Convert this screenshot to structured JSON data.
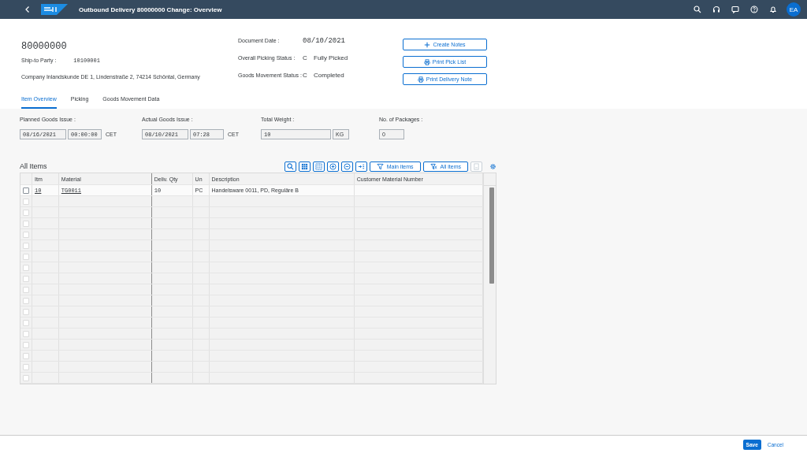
{
  "shell": {
    "title": "Outbound Delivery 80000000 Change: Overview",
    "avatar": "EA"
  },
  "header": {
    "document_number": "80000000",
    "ship_to_label": "Ship-to Party :",
    "ship_to_value": "10100001",
    "address": "Company Inlandskunde DE 1, Lindenstraße 2, 74214 Schöntal, Germany",
    "fields": [
      {
        "label": "Document Date :",
        "value": "08/10/2021",
        "kind": "date"
      },
      {
        "label": "Overall Picking Status :",
        "code": "C",
        "value": "Fully Picked",
        "kind": "status"
      },
      {
        "label": "Goods Movement Status :",
        "code": "C",
        "value": "Completed",
        "kind": "status"
      }
    ],
    "buttons": [
      {
        "label": "Create Notes"
      },
      {
        "label": "Print Pick List"
      },
      {
        "label": "Print Delivery Note"
      }
    ]
  },
  "tabs": [
    {
      "label": "Item Overview",
      "selected": true
    },
    {
      "label": "Picking",
      "selected": false
    },
    {
      "label": "Goods Movement Data",
      "selected": false
    }
  ],
  "issue_groups": [
    {
      "label": "Planned Goods Issue :",
      "inputs": [
        {
          "value": "08/16/2021",
          "kind": "date"
        },
        {
          "value": "00:00:00",
          "kind": "time"
        }
      ],
      "suffix": "CET"
    },
    {
      "label": "Actual Goods Issue :",
      "inputs": [
        {
          "value": "08/10/2021",
          "kind": "date"
        },
        {
          "value": "07:28",
          "kind": "time"
        }
      ],
      "suffix": "CET"
    },
    {
      "label": "Total Weight :",
      "inputs": [
        {
          "value": "10",
          "kind": "wide"
        },
        {
          "value": "KG",
          "kind": "unit"
        }
      ]
    },
    {
      "label": "No. of Packages :",
      "inputs": [
        {
          "value": "0",
          "kind": "unit"
        }
      ]
    }
  ],
  "table": {
    "title": "All Items",
    "toolbar": [
      {
        "kind": "icon",
        "disabled": false
      },
      {
        "kind": "icon",
        "disabled": false
      },
      {
        "kind": "icon",
        "disabled": false
      },
      {
        "kind": "icon",
        "disabled": false
      },
      {
        "kind": "icon",
        "disabled": false
      },
      {
        "kind": "icon",
        "disabled": false
      },
      {
        "kind": "text",
        "label": "Main items",
        "disabled": false
      },
      {
        "kind": "text",
        "label": "All items",
        "disabled": false
      },
      {
        "kind": "icon",
        "disabled": true
      }
    ],
    "columns": [
      {
        "label": "Itm",
        "kind": "link"
      },
      {
        "label": "Material",
        "kind": "link"
      },
      {
        "label": "Deliv. Qty",
        "kind": "mono"
      },
      {
        "label": "Un",
        "kind": "text"
      },
      {
        "label": "Description",
        "kind": "text"
      },
      {
        "label": "Customer Material Number",
        "kind": "text"
      }
    ],
    "rows": [
      {
        "selected": false,
        "cells": [
          "10",
          "TG0011",
          "10",
          "PC",
          "Handelsware 0011, PD, Reguläre B",
          ""
        ]
      },
      {
        "selected": false
      },
      {
        "selected": false
      },
      {
        "selected": false
      },
      {
        "selected": false
      },
      {
        "selected": false
      },
      {
        "selected": false
      },
      {
        "selected": false
      },
      {
        "selected": false
      },
      {
        "selected": false
      },
      {
        "selected": false
      },
      {
        "selected": false
      },
      {
        "selected": false
      },
      {
        "selected": false
      },
      {
        "selected": false
      },
      {
        "selected": false
      },
      {
        "selected": false
      },
      {
        "selected": false
      }
    ]
  },
  "footer": [
    {
      "label": "Save",
      "kind": "emphasized"
    },
    {
      "label": "Cancel",
      "kind": "transparent"
    }
  ]
}
